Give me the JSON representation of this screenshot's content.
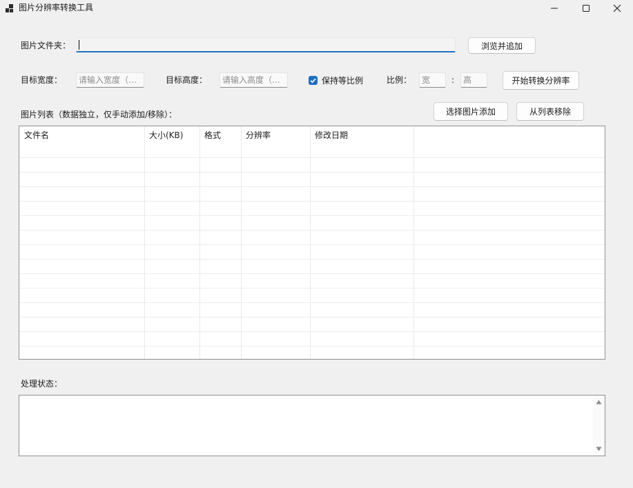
{
  "window": {
    "title": "图片分辨率转换工具",
    "icons": {
      "app": "app-icon",
      "minimize": "minimize-icon",
      "maximize": "maximize-icon",
      "close": "close-icon"
    }
  },
  "folder": {
    "label": "图片文件夹：",
    "value": "",
    "browse_button": "浏览并追加"
  },
  "resize": {
    "width_label": "目标宽度：",
    "width_placeholder": "请输入宽度（像...",
    "height_label": "目标高度：",
    "height_placeholder": "请输入高度（像...",
    "keep_ratio_label": "保持等比例",
    "keep_ratio_checked": true,
    "ratio_label": "比例：",
    "ratio_width_placeholder": "宽",
    "ratio_separator": ":",
    "ratio_height_placeholder": "高",
    "start_button": "开始转换分辨率"
  },
  "list": {
    "label": "图片列表（数据独立，仅手动添加/移除）：",
    "add_button": "选择图片添加",
    "remove_button": "从列表移除",
    "columns": [
      "文件名",
      "大小(KB)",
      "格式",
      "分辨率",
      "修改日期"
    ],
    "rows": []
  },
  "status": {
    "label": "处理状态：",
    "text": ""
  },
  "colors": {
    "accent": "#1f6fbf",
    "background": "#f0f0f0"
  }
}
